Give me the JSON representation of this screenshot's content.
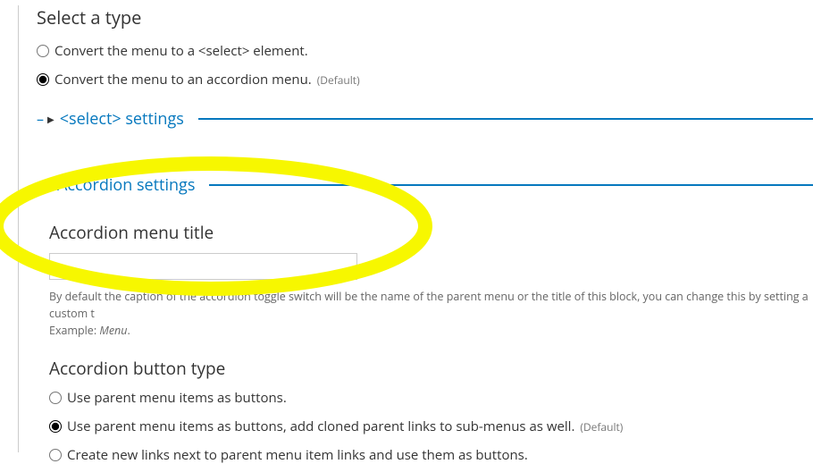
{
  "type_section": {
    "heading": "Select a type",
    "options": [
      {
        "label": "Convert the menu to a <select> element.",
        "default": false,
        "checked": false
      },
      {
        "label": "Convert the menu to an accordion menu.",
        "default": true,
        "checked": true
      }
    ]
  },
  "select_settings": {
    "title": "<select> settings"
  },
  "accordion_settings": {
    "title": "Accordion settings",
    "menu_title": {
      "label": "Accordion menu title",
      "value": "",
      "help_line1": "By default the caption of the accordion toggle switch will be the name of the parent menu or the title of this block, you can change this by setting a custom t",
      "help_line2_prefix": "Example: ",
      "help_line2_em": "Menu",
      "help_line2_suffix": "."
    },
    "button_type": {
      "label": "Accordion button type",
      "options": [
        {
          "label": "Use parent menu items as buttons.",
          "default": false,
          "checked": false
        },
        {
          "label": "Use parent menu items as buttons, add cloned parent links to sub-menus as well.",
          "default": true,
          "checked": true
        },
        {
          "label": "Create new links next to parent menu item links and use them as buttons.",
          "default": false,
          "checked": false
        }
      ]
    }
  },
  "default_text": "(Default)"
}
